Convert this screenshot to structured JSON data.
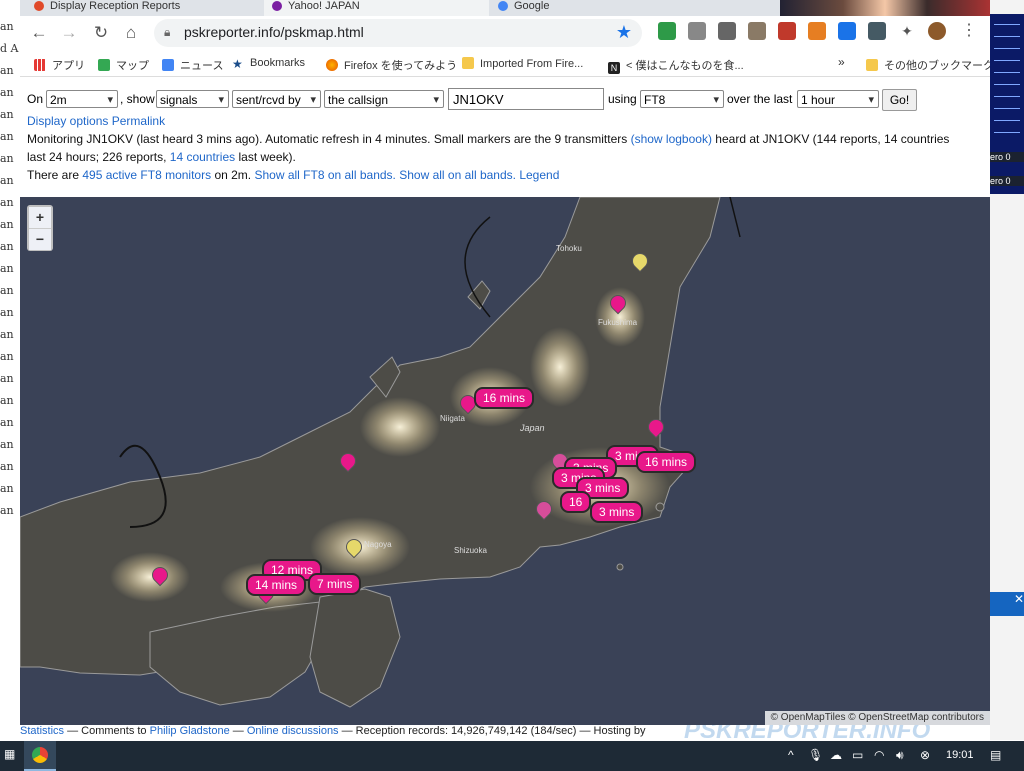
{
  "browser": {
    "tabs": [
      {
        "label": "Display Reception Reports"
      },
      {
        "label": "Yahoo! JAPAN"
      },
      {
        "label": "Google"
      }
    ],
    "url": "pskreporter.info/pskmap.html",
    "bookmarks": [
      {
        "label": "アプリ",
        "icon": "apps-grid-icon"
      },
      {
        "label": "マップ",
        "icon": "maps-pin-icon"
      },
      {
        "label": "ニュース",
        "icon": "news-icon"
      },
      {
        "label": "Bookmarks",
        "icon": "star-icon"
      },
      {
        "label": "Firefox を使ってみよう",
        "icon": "firefox-icon"
      },
      {
        "label": "Imported From Fire...",
        "icon": "folder-icon"
      },
      {
        "label": "< 僕はこんなものを食...",
        "icon": "notion-icon"
      },
      {
        "label": "その他のブックマーク",
        "icon": "folder-icon"
      }
    ],
    "bookmarks_overflow": "»",
    "ext_colors": [
      "#2e9a48",
      "#888888",
      "#666666",
      "#8a7a66",
      "#c0392b",
      "#e67e22",
      "#1a73e8",
      "#455a64",
      "#8d5a2b"
    ]
  },
  "form": {
    "on_label": "On",
    "band": "2m",
    "show_label": ", show",
    "show_value": "signals",
    "direction": "sent/rcvd by",
    "target": "the callsign",
    "callsign": "JN1OKV",
    "using_label": "using",
    "mode": "FT8",
    "over_label": "over the last",
    "period": "1 hour",
    "go_label": "Go!"
  },
  "info": {
    "display_options": "Display options",
    "permalink": "Permalink",
    "line1_pre": "Monitoring JN1OKV (last heard 3 mins ago). Automatic refresh in 4 minutes. Small markers are the 9 transmitters",
    "show_logbook": "(show logbook)",
    "line1_post": "heard at JN1OKV (144 reports, 14 countries",
    "line2_pre": "last 24 hours; 226 reports,",
    "countries": "14 countries",
    "line2_post": "last week).",
    "line3_pre": "There are",
    "monitors": "495 active FT8 monitors",
    "line3_mid": "on 2m.",
    "show_all_ft8": "Show all FT8 on all bands.",
    "show_all": "Show all on all bands.",
    "legend": "Legend"
  },
  "map": {
    "zoom_in": "+",
    "zoom_out": "−",
    "attribution": "© OpenMapTiles © OpenStreetMap contributors",
    "labels": [
      "16 mins",
      "3 mins",
      "3 mins",
      "3 mins",
      "16 mins",
      "3 mins",
      "3 mins",
      "16",
      "3 mins",
      "12 mins",
      "14 mins",
      "7 mins"
    ],
    "place_names": [
      "Tohoku",
      "Fukushima",
      "Niigata",
      "Japan",
      "Nagoya",
      "Shizuoka"
    ],
    "pin_color": "#e8188a",
    "pin_light": "#d64d9a",
    "pin_yellow": "#e6d86a"
  },
  "footer": {
    "statistics": "Statistics",
    "comments": "— Comments to",
    "author": "Philip Gladstone",
    "dash": "—",
    "online": "Online discussions",
    "records": "— Reception records: 14,926,749,142 (184/sec) — Hosting by",
    "watermark": "PSKREPORTER.INFO"
  },
  "taskbar": {
    "time": "19:01"
  },
  "background": {
    "left_text": [
      "an",
      "d A",
      "an",
      "an",
      "an",
      "an",
      "an",
      "an",
      "an",
      "an",
      "an",
      "an",
      "an",
      "an",
      "an",
      "an",
      "an",
      "an",
      "an",
      "an",
      "an",
      "an",
      "an"
    ],
    "right_text": [
      "ero 0",
      "ero 0"
    ]
  }
}
